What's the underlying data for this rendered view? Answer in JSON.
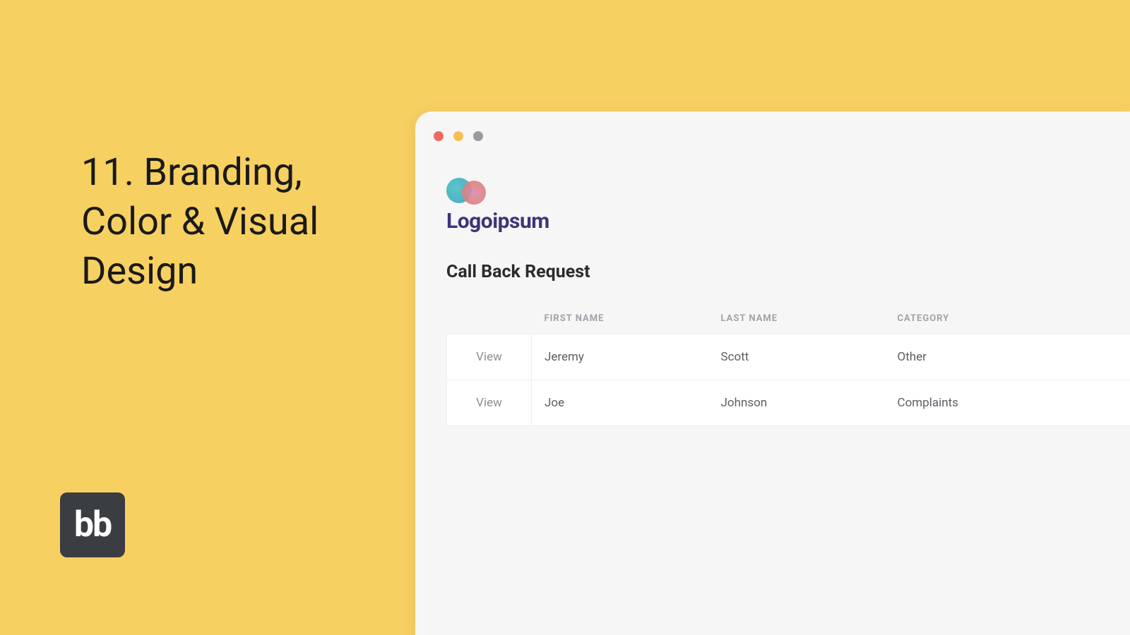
{
  "slide": {
    "headline": "11. Branding, Color & Visual Design",
    "badge_text": "bb"
  },
  "window": {
    "logo_text": "Logoipsum",
    "section_title": "Call Back Request",
    "table": {
      "headers": {
        "action": "",
        "first_name": "FIRST NAME",
        "last_name": "LAST NAME",
        "category": "CATEGORY"
      },
      "rows": [
        {
          "action": "View",
          "first_name": "Jeremy",
          "last_name": "Scott",
          "category": "Other"
        },
        {
          "action": "View",
          "first_name": "Joe",
          "last_name": "Johnson",
          "category": "Complaints"
        }
      ]
    }
  }
}
